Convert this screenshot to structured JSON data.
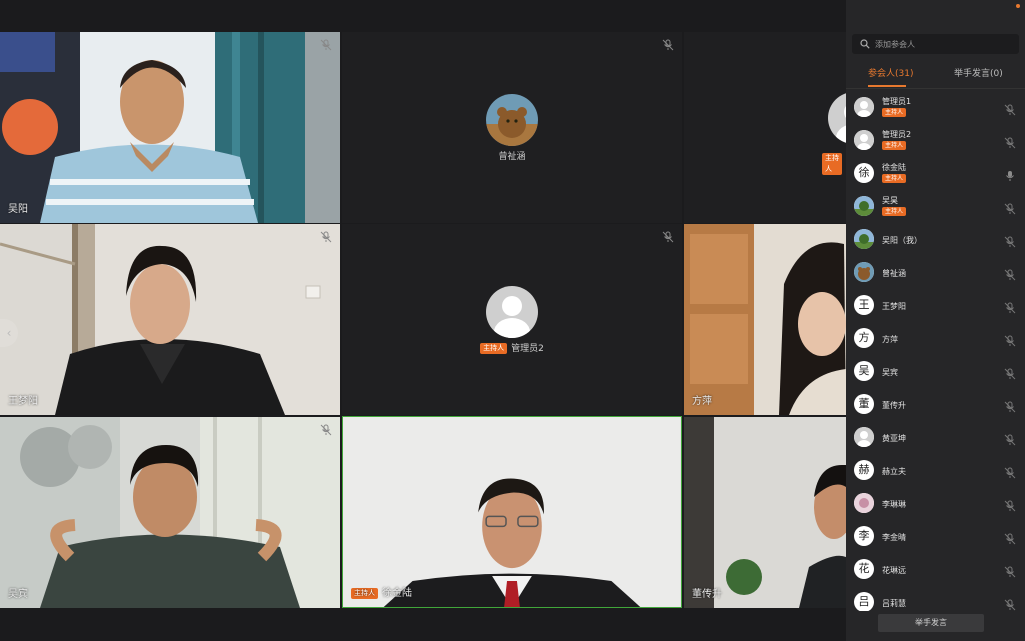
{
  "tiles": [
    {
      "name": "吴阳",
      "host": false
    },
    {
      "name": "曾祉涵",
      "host": false
    },
    {
      "name": "",
      "host_label": "主持人",
      "host": true
    },
    {
      "name": "王梦阳",
      "host": false
    },
    {
      "name": "管理员2",
      "host_label": "主持人",
      "host": true
    },
    {
      "name": "方萍",
      "host": false
    },
    {
      "name": "吴宾",
      "host": false
    },
    {
      "name": "徐金陆",
      "host_label": "主持人",
      "host": true
    },
    {
      "name": "董传升",
      "host": false
    }
  ],
  "prev_arrow": "‹",
  "sidebar": {
    "search_placeholder": "添加参会人",
    "tab_participants": "参会人(31)",
    "tab_raise_hand": "举手发言(0)",
    "raise_hand_button": "举手发言",
    "host_badge": "主持人",
    "participants": [
      {
        "name": "管理员1",
        "avatar": "gray",
        "badge": true,
        "mic": "muted"
      },
      {
        "name": "管理员2",
        "avatar": "gray",
        "badge": true,
        "mic": "muted"
      },
      {
        "name": "徐金陆",
        "avatar": "徐",
        "badge": true,
        "mic": "on"
      },
      {
        "name": "吴昊",
        "avatar": "tree",
        "badge": true,
        "mic": "muted"
      },
      {
        "name": "吴阳（我）",
        "avatar": "tree",
        "badge": false,
        "mic": "muted"
      },
      {
        "name": "曾祉涵",
        "avatar": "bear",
        "badge": false,
        "mic": "muted"
      },
      {
        "name": "王梦阳",
        "avatar": "王",
        "badge": false,
        "mic": "muted"
      },
      {
        "name": "方萍",
        "avatar": "方",
        "badge": false,
        "mic": "muted"
      },
      {
        "name": "吴宾",
        "avatar": "吴",
        "badge": false,
        "mic": "muted"
      },
      {
        "name": "董传升",
        "avatar": "董",
        "badge": false,
        "mic": "muted"
      },
      {
        "name": "黄亚坤",
        "avatar": "gray",
        "badge": false,
        "mic": "muted"
      },
      {
        "name": "赫立夫",
        "avatar": "赫",
        "badge": false,
        "mic": "muted"
      },
      {
        "name": "李琳琳",
        "avatar": "flower",
        "badge": false,
        "mic": "muted"
      },
      {
        "name": "李金晴",
        "avatar": "李",
        "badge": false,
        "mic": "muted"
      },
      {
        "name": "花琳远",
        "avatar": "花",
        "badge": false,
        "mic": "muted"
      },
      {
        "name": "吕莉慧",
        "avatar": "吕",
        "badge": false,
        "mic": "muted"
      }
    ]
  },
  "colors": {
    "accent": "#e8792f",
    "active_border": "#41a63a",
    "host_badge": "#e86b24"
  }
}
